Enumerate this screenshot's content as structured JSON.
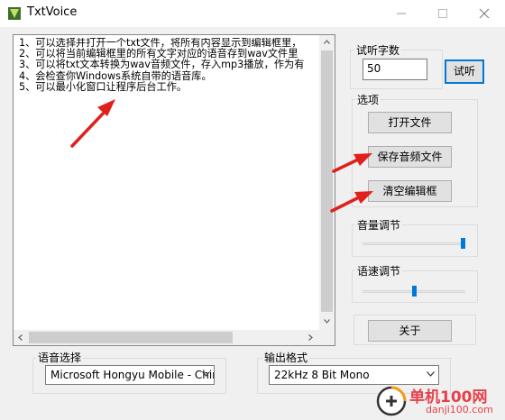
{
  "window": {
    "title": "TxtVoice",
    "icons": {
      "app": "txtvoice-app-icon",
      "minimize": "minimize-icon",
      "maximize": "maximize-icon",
      "close": "close-icon"
    }
  },
  "editor": {
    "lines": [
      "1、可以选择并打开一个txt文件，将所有内容显示到编辑框里，",
      "2、可以将当前编辑框里的所有文字对应的语音存到wav文件里",
      "3、可以将txt文本转换为wav音频文件，存入mp3播放，作为有",
      "4、会检查你Windows系统自带的语音库。",
      "5、可以最小化窗口让程序后台工作。"
    ]
  },
  "trial": {
    "group_label": "试听字数",
    "input_value": "50",
    "button_label": "试听"
  },
  "options": {
    "group_label": "选项",
    "open_file": "打开文件",
    "save_audio": "保存音频文件",
    "clear_editor": "清空编辑框"
  },
  "volume": {
    "label": "音量调节",
    "level": 1.0
  },
  "speed": {
    "label": "语速调节",
    "level": 0.5
  },
  "about": {
    "label": "关于"
  },
  "voice": {
    "label": "语音选择",
    "selected": "Microsoft Hongyu Mobile - Chin"
  },
  "format": {
    "label": "输出格式",
    "selected": "22kHz 8 Bit Mono"
  },
  "watermark": {
    "main": "单机100网",
    "sub": "danji100.com"
  },
  "colors": {
    "accent": "#0078d7",
    "arrow": "#e0201c",
    "watermark": "#e8404a"
  }
}
